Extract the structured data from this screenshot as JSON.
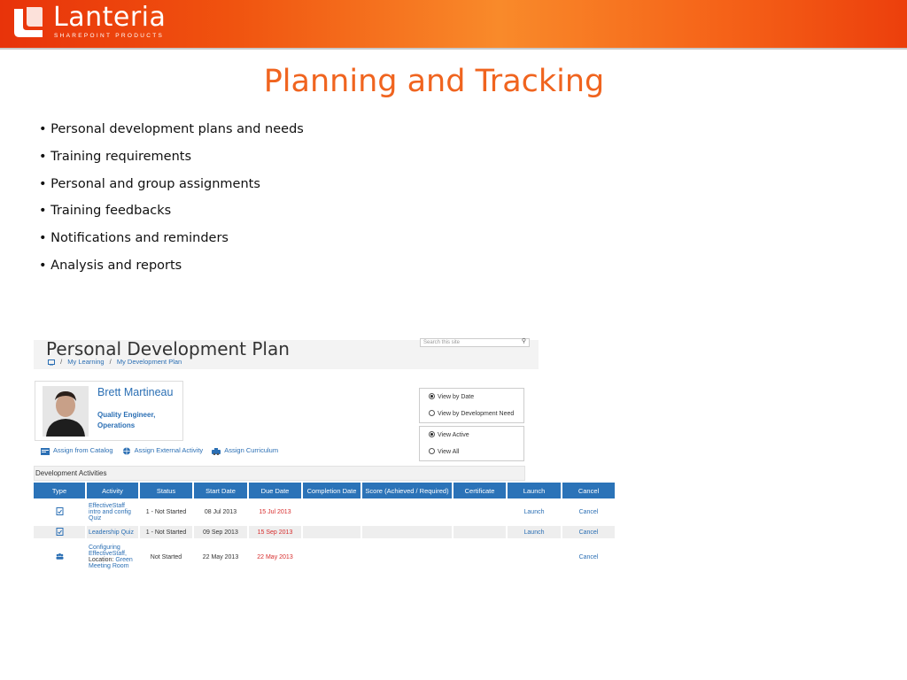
{
  "brand": {
    "name": "Lanteria",
    "tagline": "SHAREPOINT PRODUCTS"
  },
  "slide": {
    "title": "Planning and Tracking",
    "bullets": [
      "• Personal development plans and needs",
      "• Training requirements",
      "• Personal and group assignments",
      "• Training feedbacks",
      "• Notifications and reminders",
      "• Analysis and reports"
    ]
  },
  "screenshot": {
    "page_title": "Personal Development Plan",
    "search_placeholder": "Search this site",
    "breadcrumb": [
      "My Learning",
      "My Development Plan"
    ],
    "breadcrumb_sep": "/",
    "profile": {
      "name": "Brett Martineau",
      "job_title": "Quality Engineer,",
      "department": "Operations"
    },
    "view_options_1": [
      {
        "label": "View by Date",
        "selected": true
      },
      {
        "label": "View by Development Need",
        "selected": false
      }
    ],
    "view_options_2": [
      {
        "label": "View Active",
        "selected": true
      },
      {
        "label": "View All",
        "selected": false
      }
    ],
    "actions": [
      "Assign from Catalog",
      "Assign External Activity",
      "Assign Curriculum"
    ],
    "section_title": "Development Activities",
    "table": {
      "headers": [
        "Type",
        "Activity",
        "Status",
        "Start Date",
        "Due Date",
        "Completion Date",
        "Score (Achieved / Required)",
        "Certificate",
        "Launch",
        "Cancel"
      ],
      "rows": [
        {
          "type_icon": "quiz-icon",
          "activity": "EffectiveStaff intro and config Quiz",
          "status": "1 - Not Started",
          "start": "08 Jul 2013",
          "due": "15 Jul 2013",
          "completion": "",
          "score": "",
          "certificate": "",
          "launch": "Launch",
          "cancel": "Cancel"
        },
        {
          "type_icon": "quiz-icon",
          "activity": "Leadership Quiz",
          "status": "1 - Not Started",
          "start": "09 Sep 2013",
          "due": "15 Sep 2013",
          "completion": "",
          "score": "",
          "certificate": "",
          "launch": "Launch",
          "cancel": "Cancel"
        },
        {
          "type_icon": "classroom-icon",
          "activity": "Configuring EffectiveStaff,",
          "activity_extra": "Location: ",
          "activity_location": "Green Meeting Room",
          "status": "Not Started",
          "start": "22 May 2013",
          "due": "22 May 2013",
          "completion": "",
          "score": "",
          "certificate": "",
          "launch": "",
          "cancel": "Cancel"
        }
      ]
    }
  },
  "colors": {
    "accent_orange": "#f0641f",
    "link_blue": "#2b6fb4",
    "header_blue": "#2b73b8",
    "due_red": "#d72d2d"
  }
}
